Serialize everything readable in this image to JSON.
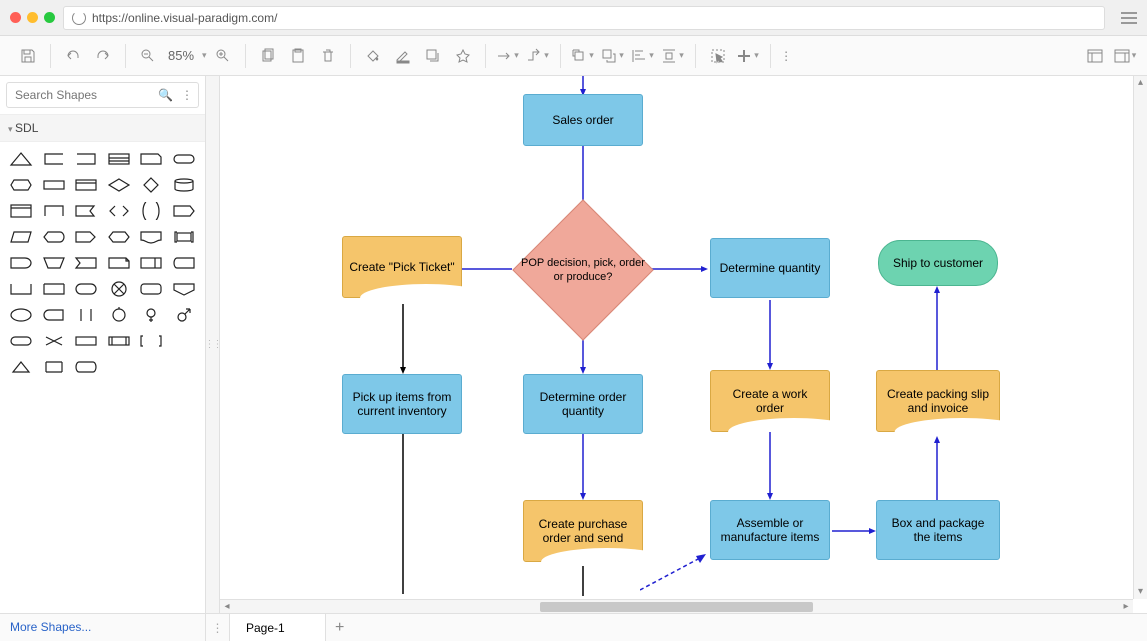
{
  "browser": {
    "url": "https://online.visual-paradigm.com/"
  },
  "toolbar": {
    "zoom": "85%"
  },
  "sidebar": {
    "search_placeholder": "Search Shapes",
    "category": "SDL",
    "more_shapes": "More Shapes..."
  },
  "tabs": {
    "page1": "Page-1"
  },
  "flowchart": {
    "nodes": {
      "sales_order": {
        "label": "Sales order",
        "type": "process"
      },
      "pop_decision": {
        "label": "POP decision, pick, order or produce?",
        "type": "decision"
      },
      "pick_ticket": {
        "label": "Create \"Pick Ticket\"",
        "type": "document"
      },
      "determine_qty": {
        "label": "Determine quantity",
        "type": "process"
      },
      "ship": {
        "label": "Ship to customer",
        "type": "terminal"
      },
      "pickup_items": {
        "label": "Pick up items from current inventory",
        "type": "process"
      },
      "determine_order_qty": {
        "label": "Determine order quantity",
        "type": "process"
      },
      "create_work_order": {
        "label": "Create a work order",
        "type": "document"
      },
      "packing_slip": {
        "label": "Create packing slip and invoice",
        "type": "document"
      },
      "purchase_order": {
        "label": "Create purchase order and send",
        "type": "document"
      },
      "assemble": {
        "label": "Assemble or manufacture items",
        "type": "process"
      },
      "box_package": {
        "label": "Box and package the items",
        "type": "process"
      }
    },
    "edges": [
      [
        "(top)",
        "sales_order"
      ],
      [
        "sales_order",
        "pop_decision"
      ],
      [
        "pop_decision",
        "pick_ticket"
      ],
      [
        "pop_decision",
        "determine_qty"
      ],
      [
        "pop_decision",
        "determine_order_qty"
      ],
      [
        "pick_ticket",
        "pickup_items"
      ],
      [
        "determine_qty",
        "create_work_order"
      ],
      [
        "determine_order_qty",
        "purchase_order"
      ],
      [
        "create_work_order",
        "assemble"
      ],
      [
        "assemble",
        "box_package"
      ],
      [
        "box_package",
        "packing_slip"
      ],
      [
        "packing_slip",
        "ship"
      ]
    ]
  }
}
